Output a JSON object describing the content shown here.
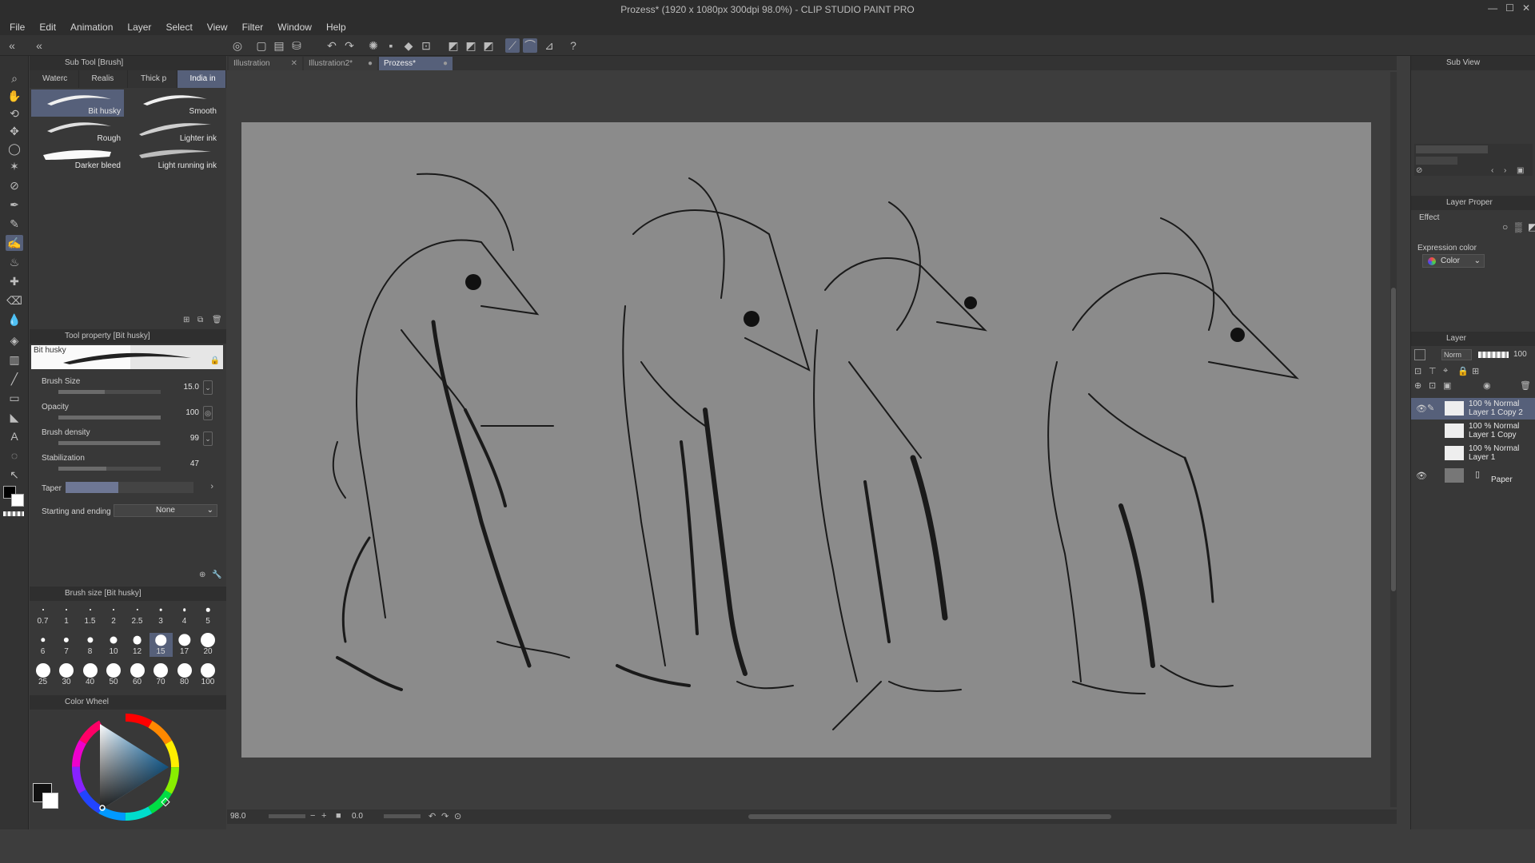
{
  "window": {
    "title": "Prozess* (1920 x 1080px 300dpi 98.0%) - CLIP STUDIO PAINT PRO",
    "controls": [
      "—",
      "☐",
      "✕"
    ]
  },
  "menu": [
    "File",
    "Edit",
    "Animation",
    "Layer",
    "Select",
    "View",
    "Filter",
    "Window",
    "Help"
  ],
  "sub_tool": {
    "header": "Sub Tool [Brush]",
    "tabs": [
      "Waterc",
      "Realis",
      "Thick p",
      "India in"
    ],
    "brushes": [
      "Bit husky",
      "Smooth",
      "Rough",
      "Lighter ink",
      "Darker bleed",
      "Light running ink"
    ]
  },
  "tool_property": {
    "header": "Tool property [Bit husky]",
    "preset": "Bit husky",
    "brush_size": {
      "label": "Brush Size",
      "value": "15.0"
    },
    "opacity": {
      "label": "Opacity",
      "value": "100"
    },
    "density": {
      "label": "Brush density",
      "value": "99"
    },
    "stabilization": {
      "label": "Stabilization",
      "value": "47"
    },
    "taper": {
      "label": "Taper"
    },
    "start_end": {
      "label": "Starting and ending",
      "value": "None"
    }
  },
  "brush_size_panel": {
    "header": "Brush size [Bit husky]",
    "sizes": [
      "0.7",
      "1",
      "1.5",
      "2",
      "2.5",
      "3",
      "4",
      "5",
      "6",
      "7",
      "8",
      "10",
      "12",
      "15",
      "17",
      "20",
      "25",
      "30",
      "40",
      "50",
      "60",
      "70",
      "80",
      "100"
    ],
    "selected": "15"
  },
  "color_panel": {
    "header": "Color Wheel"
  },
  "doc_tabs": [
    {
      "label": "Illustration"
    },
    {
      "label": "Illustration2*"
    },
    {
      "label": "Prozess*"
    }
  ],
  "status": {
    "zoom": "98.0",
    "angle": "0.0"
  },
  "sub_view": {
    "header": "Sub View"
  },
  "layer_property": {
    "header": "Layer Proper",
    "effect": "Effect",
    "expression_color": "Expression color",
    "color_value": "Color"
  },
  "layer_panel": {
    "header": "Layer",
    "blend": "Norm",
    "opacity": "100",
    "layers": [
      {
        "l1": "100 % Normal",
        "l2": "Layer 1 Copy 2"
      },
      {
        "l1": "100 % Normal",
        "l2": "Layer 1 Copy"
      },
      {
        "l1": "100 % Normal",
        "l2": "Layer 1"
      },
      {
        "l1": "",
        "l2": "Paper"
      }
    ]
  },
  "icons": {
    "tools": [
      "zoom-icon",
      "hand-icon",
      "rotate-icon",
      "move-icon",
      "lasso-icon",
      "magic-wand-icon",
      "eyedropper-icon",
      "pen-icon",
      "pencil-icon",
      "brush-icon",
      "airbrush-icon",
      "decoration-icon",
      "eraser-icon",
      "blend-icon",
      "fill-icon",
      "gradient-icon",
      "figure-icon",
      "frame-icon",
      "ruler-icon",
      "text-icon",
      "balloon-icon",
      "correct-line-icon"
    ]
  }
}
